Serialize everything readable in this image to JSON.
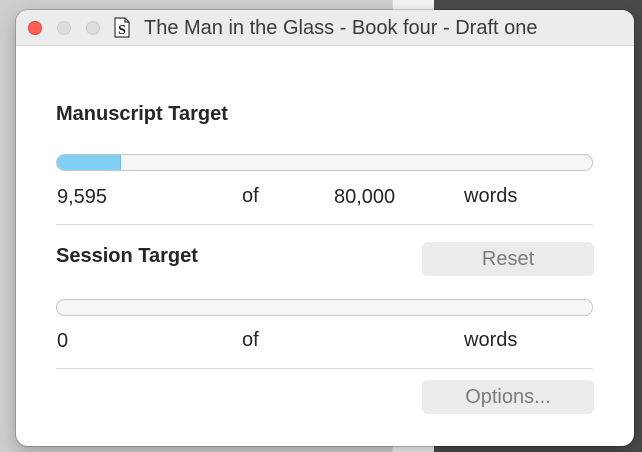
{
  "window": {
    "title": "The Man in the Glass - Book four - Draft one",
    "doc_icon_glyph": "S"
  },
  "manuscript": {
    "heading": "Manuscript Target",
    "current": "9,595",
    "of": "of",
    "target": "80,000",
    "unit": "words",
    "progress_fraction": 0.12
  },
  "session": {
    "heading": "Session Target",
    "reset_label": "Reset",
    "current": "0",
    "of": "of",
    "unit": "words",
    "progress_fraction": 0.0
  },
  "footer": {
    "options_label": "Options..."
  },
  "colors": {
    "progress_fill": "#7fd0f4",
    "close_button": "#fe5f57"
  }
}
